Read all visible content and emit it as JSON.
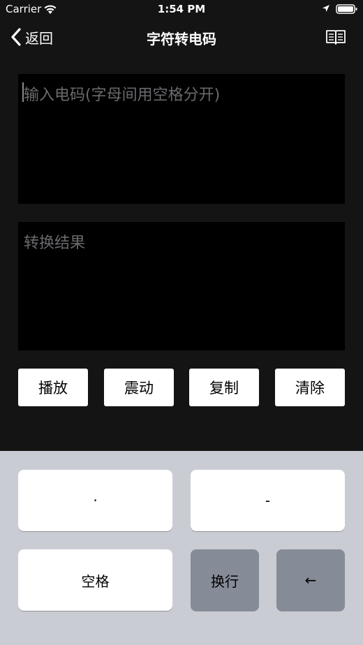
{
  "status_bar": {
    "carrier": "Carrier",
    "time": "1:54 PM"
  },
  "nav": {
    "back_label": "返回",
    "title": "字符转电码"
  },
  "input": {
    "placeholder": "输入电码(字母间用空格分开)"
  },
  "result": {
    "placeholder": "转换结果"
  },
  "actions": {
    "play": "播放",
    "vibrate": "震动",
    "copy": "复制",
    "clear": "清除"
  },
  "keyboard": {
    "dot": "·",
    "dash": "-",
    "space": "空格",
    "newline": "换行",
    "backspace": "←"
  },
  "colors": {
    "background": "#141414",
    "text_area": "#000000",
    "keyboard": "#c9ccd3",
    "dark_key": "#868b98"
  },
  "icons": [
    "wifi-icon",
    "location-icon",
    "battery-icon",
    "chevron-left-icon",
    "book-icon"
  ]
}
